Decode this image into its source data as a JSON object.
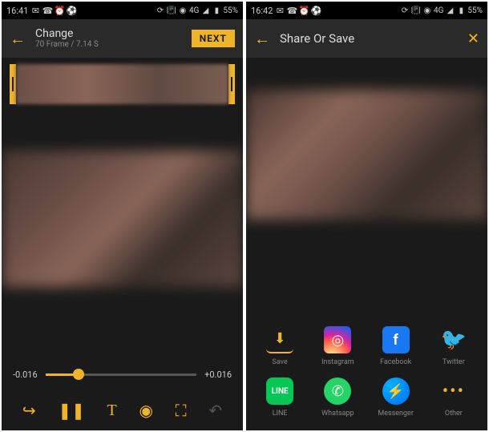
{
  "left": {
    "status": {
      "time": "16:41",
      "network": "4G",
      "battery": "55%"
    },
    "header": {
      "title": "Change",
      "subtitle": "70 Frame / 7.14 S",
      "next": "NEXT"
    },
    "slider": {
      "min": "-0.016",
      "max": "+0.016"
    }
  },
  "right": {
    "status": {
      "time": "16:42",
      "network": "4G",
      "battery": "55%"
    },
    "header": {
      "title": "Share Or Save"
    },
    "share": [
      {
        "label": "Save"
      },
      {
        "label": "Instagram"
      },
      {
        "label": "Facebook"
      },
      {
        "label": "Twitter"
      },
      {
        "label": "LINE"
      },
      {
        "label": "Whatsapp"
      },
      {
        "label": "Messenger"
      },
      {
        "label": "Other"
      }
    ]
  }
}
